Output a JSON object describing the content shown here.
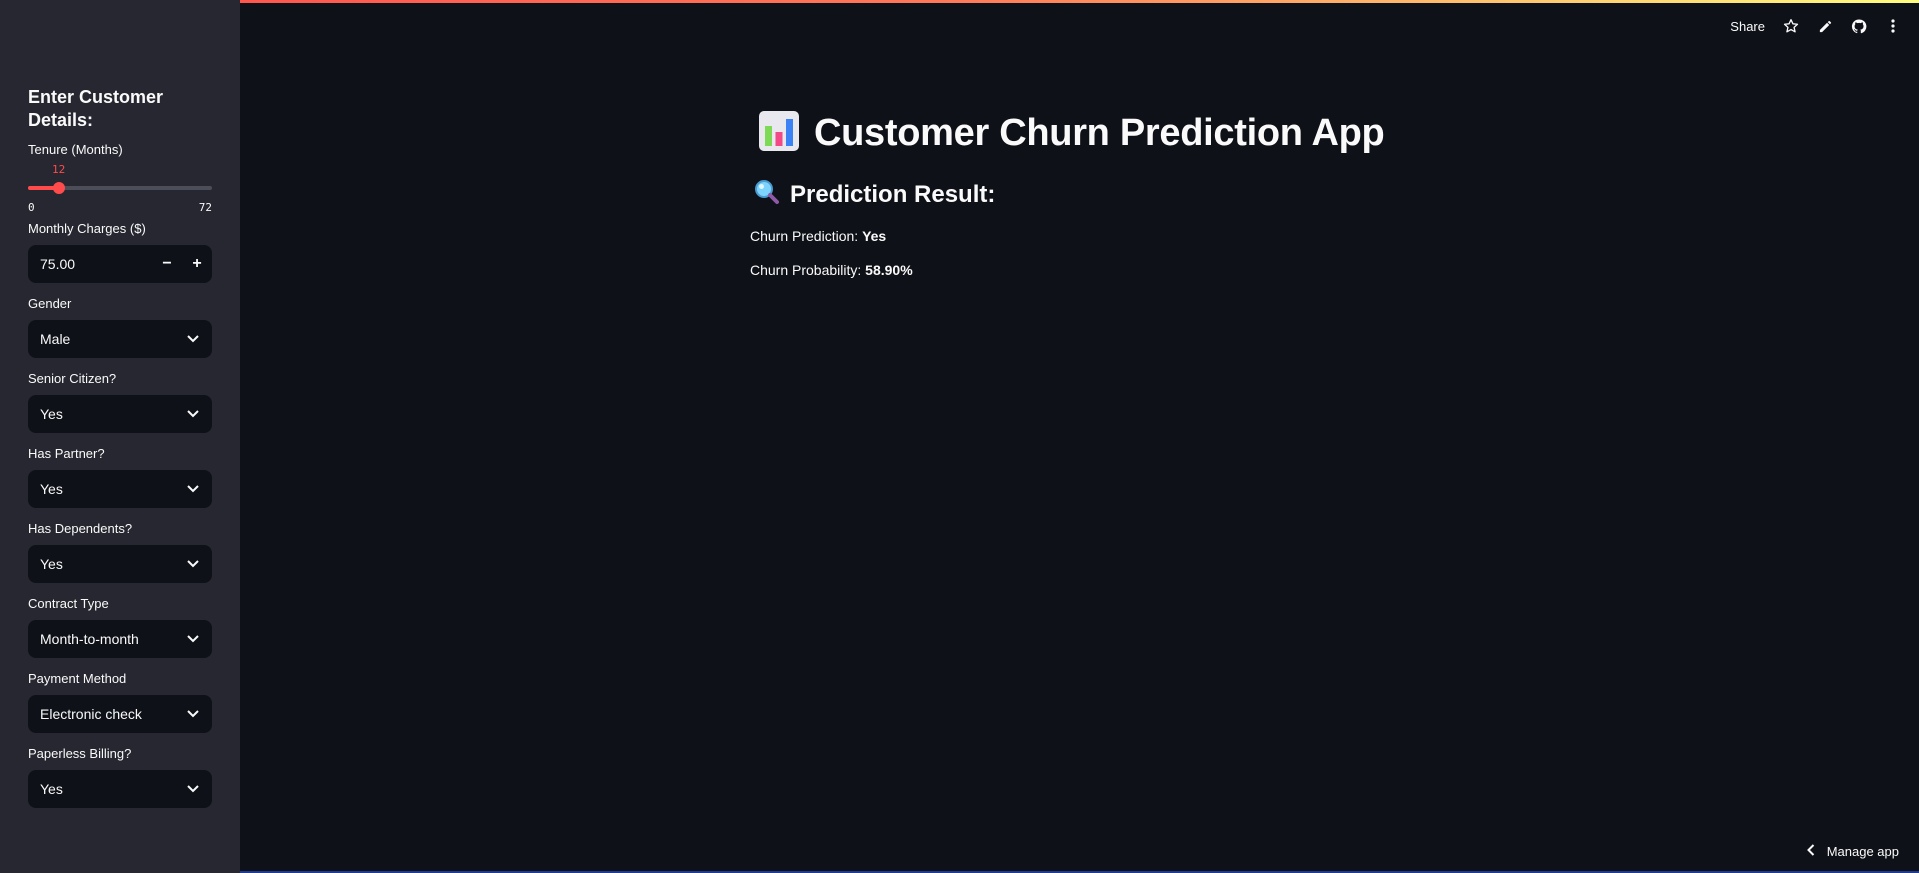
{
  "sidebar": {
    "title": "Enter Customer Details:",
    "tenure": {
      "label": "Tenure (Months)",
      "value": "12",
      "min": "0",
      "max": "72",
      "fraction": 0.1667
    },
    "monthly_charges": {
      "label": "Monthly Charges ($)",
      "value": "75.00",
      "minus": "−",
      "plus": "+"
    },
    "gender": {
      "label": "Gender",
      "value": "Male"
    },
    "senior": {
      "label": "Senior Citizen?",
      "value": "Yes"
    },
    "partner": {
      "label": "Has Partner?",
      "value": "Yes"
    },
    "dependents": {
      "label": "Has Dependents?",
      "value": "Yes"
    },
    "contract": {
      "label": "Contract Type",
      "value": "Month-to-month"
    },
    "payment": {
      "label": "Payment Method",
      "value": "Electronic check"
    },
    "paperless": {
      "label": "Paperless Billing?",
      "value": "Yes"
    }
  },
  "toolbar": {
    "share_label": "Share",
    "icons": [
      "star-icon",
      "pencil-icon",
      "github-icon",
      "more-vertical-icon"
    ]
  },
  "main": {
    "title": "Customer Churn Prediction App",
    "title_icon": "bar-chart-icon",
    "subtitle": "Prediction Result:",
    "subtitle_icon": "magnifier-icon",
    "prediction_label": "Churn Prediction:",
    "prediction_value": "Yes",
    "probability_label": "Churn Probability:",
    "probability_value": "58.90%"
  },
  "footer": {
    "manage_label": "Manage app"
  },
  "colors": {
    "accent": "#ff4b4b",
    "background": "#0e1117",
    "sidebar": "#262730"
  }
}
